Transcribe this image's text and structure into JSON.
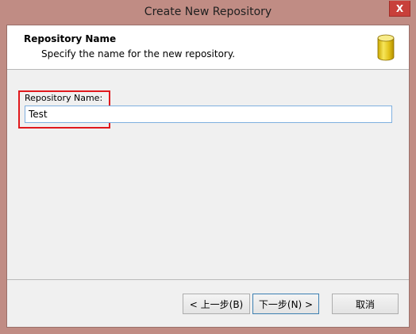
{
  "window": {
    "title": "Create New Repository",
    "close_glyph": "X"
  },
  "header": {
    "title": "Repository Name",
    "subtitle": "Specify the name for the new repository.",
    "icon": "database-icon"
  },
  "form": {
    "label": "Repository Name:",
    "value": "Test"
  },
  "buttons": {
    "back": "< 上一步(B)",
    "next": "下一步(N) >",
    "cancel": "取消"
  },
  "colors": {
    "window_frame": "#c08c84",
    "close_button": "#c8403a",
    "highlight": "#e0181c",
    "input_border": "#7fb0df",
    "primary_button_border": "#3c7fb1"
  }
}
